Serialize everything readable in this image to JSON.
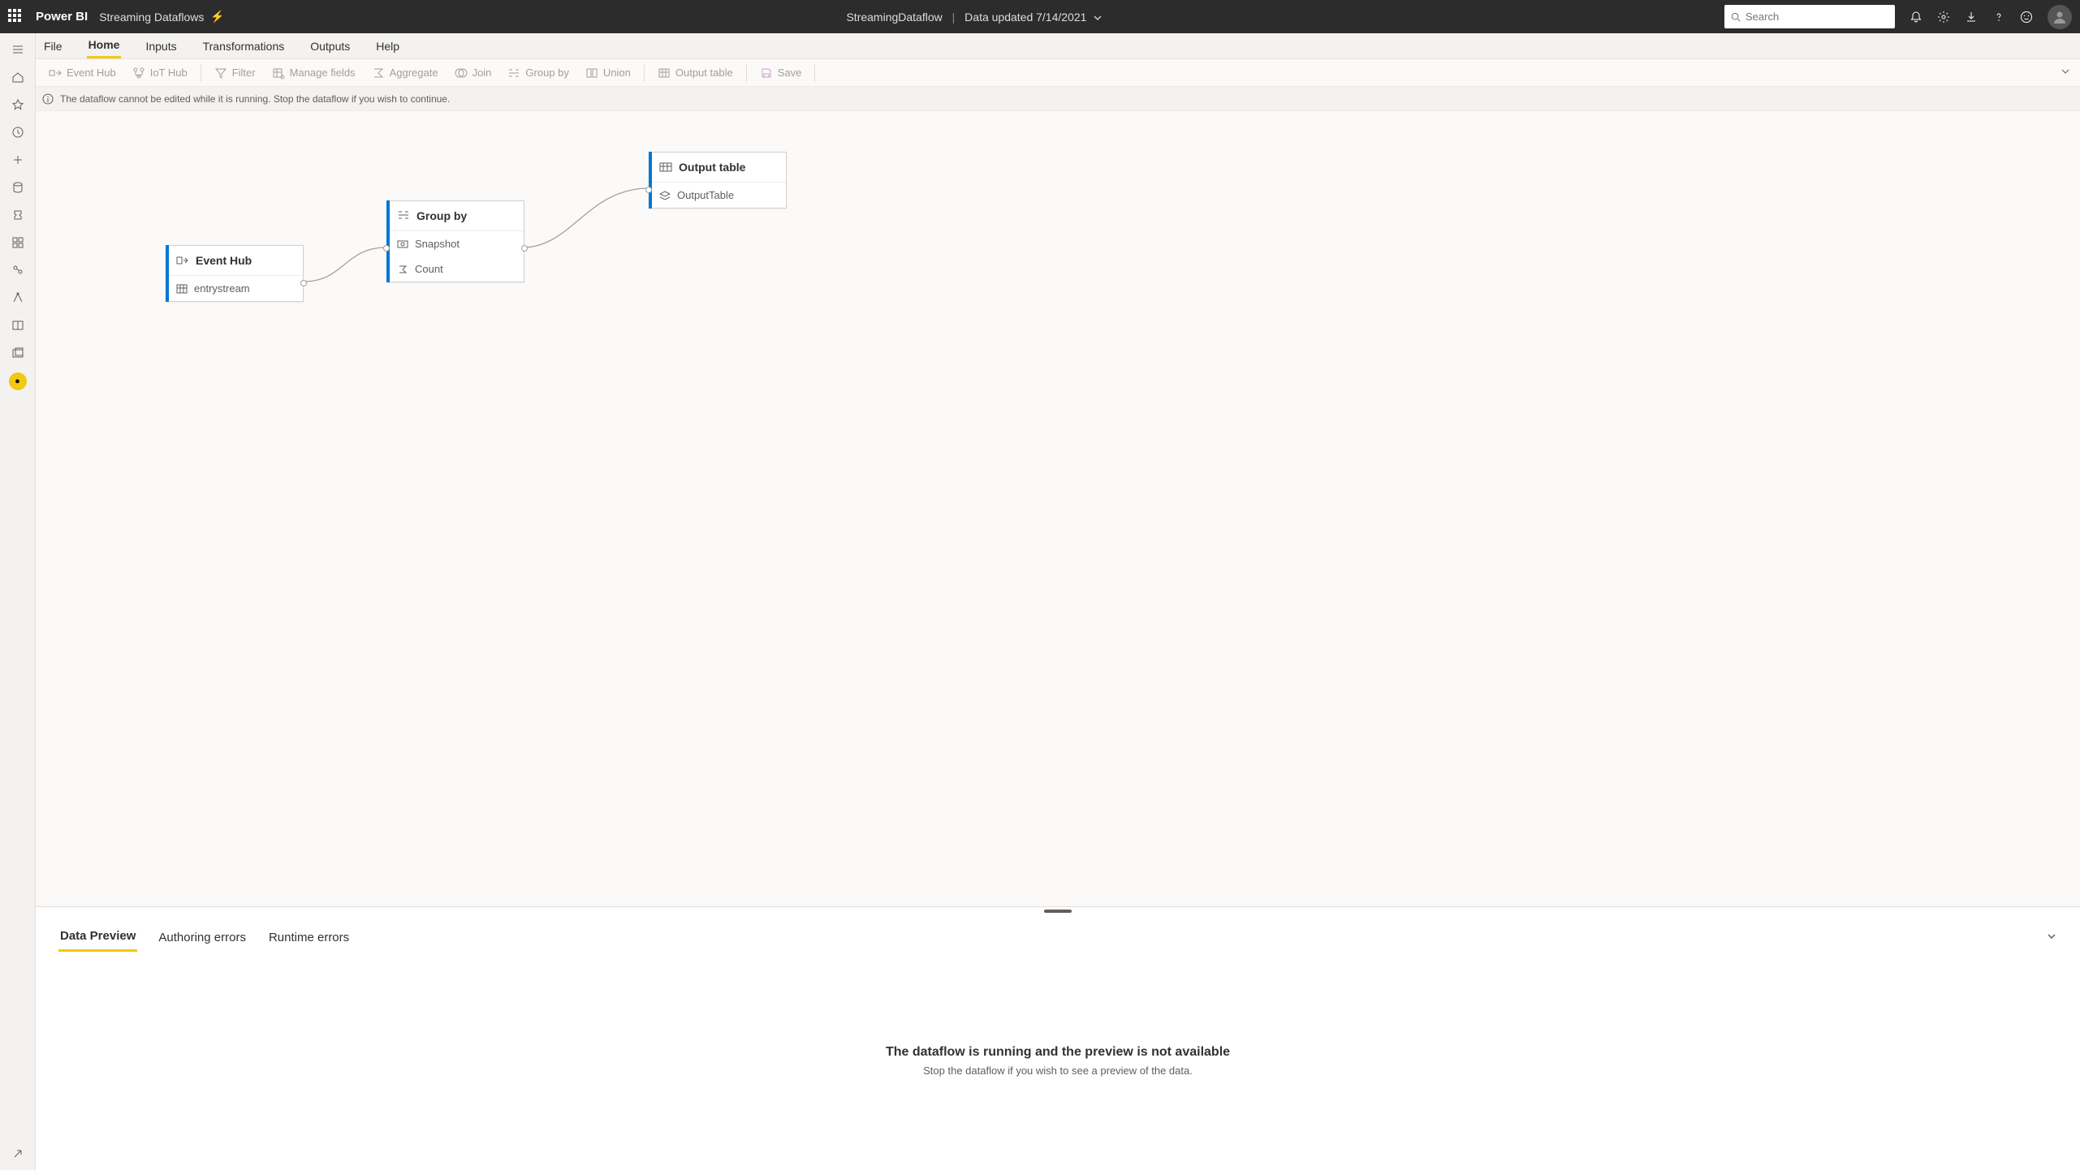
{
  "topbar": {
    "app": "Power BI",
    "doc": "Streaming Dataflows",
    "center_name": "StreamingDataflow",
    "center_status": "Data updated 7/14/2021"
  },
  "search": {
    "placeholder": "Search"
  },
  "menubar": [
    "File",
    "Home",
    "Inputs",
    "Transformations",
    "Outputs",
    "Help"
  ],
  "ribbon": {
    "items": [
      "Event Hub",
      "IoT Hub",
      "Filter",
      "Manage fields",
      "Aggregate",
      "Join",
      "Group by",
      "Union",
      "Output table",
      "Save"
    ]
  },
  "infobar": "The dataflow cannot be edited while it is running. Stop the dataflow if you wish to continue.",
  "nodes": {
    "eventhub": {
      "title": "Event Hub",
      "row1": "entrystream"
    },
    "groupby": {
      "title": "Group by",
      "row1": "Snapshot",
      "row2": "Count"
    },
    "output": {
      "title": "Output table",
      "row1": "OutputTable"
    }
  },
  "bottom": {
    "tabs": [
      "Data Preview",
      "Authoring errors",
      "Runtime errors"
    ],
    "msg_title": "The dataflow is running and the preview is not available",
    "msg_sub": "Stop the dataflow if you wish to see a preview of the data."
  }
}
